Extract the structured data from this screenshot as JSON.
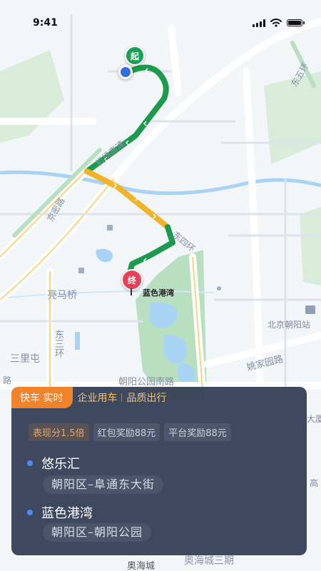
{
  "status_bar": {
    "time": "9:41"
  },
  "map": {
    "labels": {
      "road_top_right": "东五环",
      "road_middle": "机场高速",
      "road_left": "京密路",
      "road_east4": "东四环",
      "bridge": "亮马桥",
      "road_east3": "东三环",
      "sanlitun": "三里屯",
      "road_left_edge": "路",
      "chaoyang_park_south": "朝阳公园南路",
      "yaojiayuan": "姚家园路",
      "chaoyang_station": "北京朝阳站",
      "aoyang": "奥海城",
      "aoyang3": "奥海城三期",
      "right_edge_top": "大厦",
      "right_edge_mid": "高"
    },
    "markers": {
      "start_label": "起",
      "end_label": "终",
      "destination_label": "蓝色港湾"
    },
    "colors": {
      "route_green": "#1c9a4e",
      "route_yellow": "#f0b429",
      "water": "#a9d3f5",
      "park": "#b8dfbf"
    }
  },
  "panel": {
    "tabs": [
      "快车 实时",
      "企业用车",
      "品质出行"
    ],
    "active_tab": "快车 实时",
    "badges": [
      "表现分1.5倍",
      "红包奖励88元",
      "平台奖励88元"
    ],
    "origin": {
      "name": "悠乐汇",
      "address": "朝阳区–阜通东大街"
    },
    "destination": {
      "name": "蓝色港湾",
      "address": "朝阳区–朝阳公园"
    }
  }
}
